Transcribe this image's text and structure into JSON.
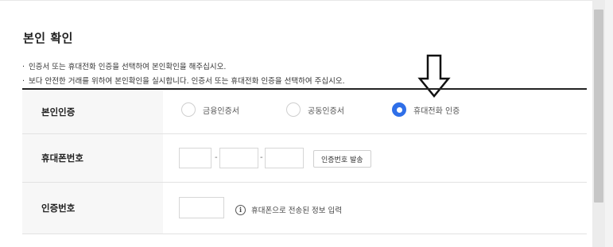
{
  "section": {
    "title": "본인 확인",
    "notes": [
      "인증서 또는 휴대전화 인증을 선택하여 본인확인을 해주십시오.",
      "보다 안전한 거래를 위하여 본인확인을 실시합니다. 인증서 또는 휴대전화 인증을 선택하여 주십시오."
    ],
    "bullet": "·"
  },
  "form": {
    "auth_method": {
      "label": "본인인증",
      "options": [
        {
          "label": "금융인증서",
          "selected": false
        },
        {
          "label": "공동인증서",
          "selected": false
        },
        {
          "label": "휴대전화 인증",
          "selected": true
        }
      ]
    },
    "phone": {
      "label": "휴대폰번호",
      "part1": "",
      "part2": "",
      "part3": "",
      "separator": "-",
      "send_button": "인증번호 발송"
    },
    "code": {
      "label": "인증번호",
      "value": "",
      "info_icon": "info-icon",
      "info_symbol": "i",
      "info_text": "휴대폰으로 전송된 정보 입력"
    }
  },
  "annotation": {
    "icon": "down-arrow-icon"
  },
  "colors": {
    "accent": "#2f6fe8",
    "label_bg": "#f7f7f7",
    "border": "#e2e2e2"
  }
}
